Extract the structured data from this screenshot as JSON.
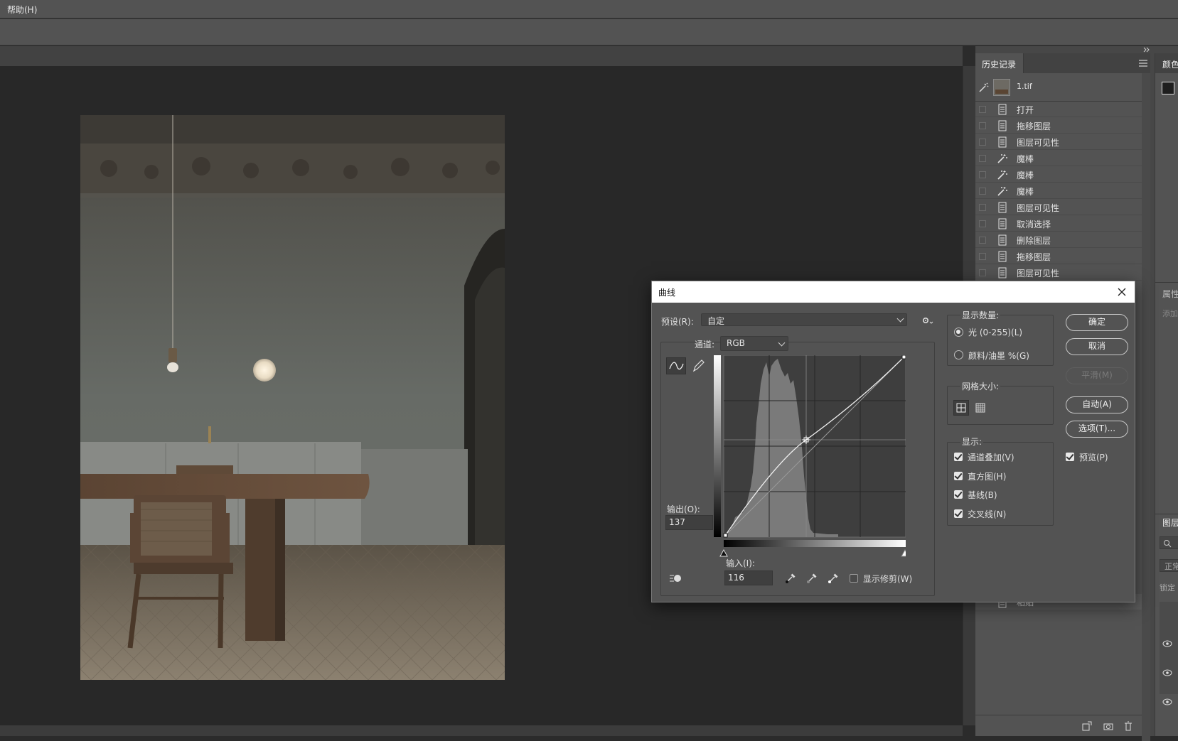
{
  "menubar": {
    "help": "帮助(H)"
  },
  "history": {
    "tab_label": "历史记录",
    "snapshot": "1.tif",
    "items": [
      "打开",
      "拖移图层",
      "图层可见性",
      "魔棒",
      "魔棒",
      "魔棒",
      "图层可见性",
      "取消选择",
      "删除图层",
      "拖移图层",
      "图层可见性"
    ],
    "item_icons": [
      "doc-icon",
      "doc-icon",
      "doc-icon",
      "magic-wand-icon",
      "magic-wand-icon",
      "magic-wand-icon",
      "doc-icon",
      "doc-icon",
      "doc-icon",
      "doc-icon",
      "doc-icon"
    ],
    "hidden_item": "粘贴"
  },
  "right_panel": {
    "color_tab": "颜色",
    "properties_tab": "属性",
    "properties_hint": "添加",
    "layers_tab": "图层",
    "blend_mode": "正常",
    "lock_label": "锁定"
  },
  "curves": {
    "title": "曲线",
    "preset_label": "预设(R):",
    "preset_value": "自定",
    "channel_label": "通道:",
    "channel_value": "RGB",
    "output_label": "输出(O):",
    "output_value": "137",
    "input_label": "输入(I):",
    "input_value": "116",
    "show_clipping": "显示修剪(W)",
    "display_amount_title": "显示数量:",
    "light_option": "光 (0-255)(L)",
    "pigment_option": "颜料/油墨 %(G)",
    "grid_size_title": "网格大小:",
    "show_title": "显示:",
    "channel_overlay": "通道叠加(V)",
    "histogram": "直方图(H)",
    "baseline": "基线(B)",
    "intersection": "交叉线(N)",
    "ok": "确定",
    "cancel": "取消",
    "smooth": "平滑(M)",
    "auto": "自动(A)",
    "options": "选项(T)...",
    "preview": "预览(P)"
  },
  "colors": {
    "panel": "#535353",
    "canvas": "#282828",
    "dialog_title": "#ffffff"
  }
}
